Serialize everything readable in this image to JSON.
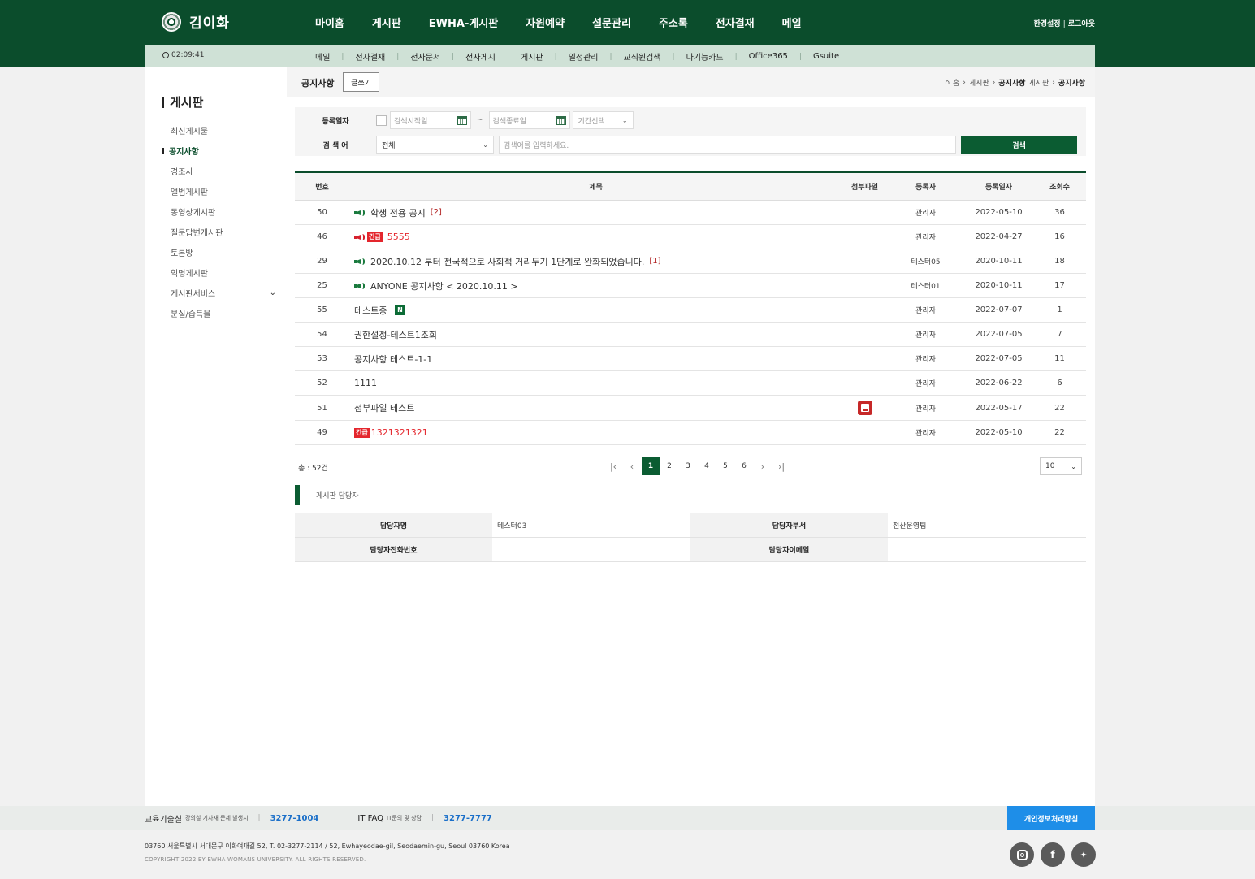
{
  "header": {
    "logo_name": "김이화",
    "gnb": [
      "마이홈",
      "게시판",
      "EWHA-게시판",
      "자원예약",
      "설문관리",
      "주소록",
      "전자결재",
      "메일"
    ],
    "util": {
      "settings": "환경설정",
      "logout": "로그아웃"
    }
  },
  "subbar": {
    "timer": "02:09:41",
    "items": [
      "메일",
      "전자결재",
      "전자문서",
      "전자게시",
      "게시판",
      "일정관리",
      "교직원검색",
      "다기능카드",
      "Office365",
      "Gsuite"
    ]
  },
  "lnb": {
    "title": "게시판",
    "items": [
      "최신게시물",
      "공지사항",
      "경조사",
      "앨범게시판",
      "동영상게시판",
      "질문답변게시판",
      "토론방",
      "익명게시판",
      "게시판서비스",
      "분실/습득물"
    ]
  },
  "content": {
    "page_title": "공지사항",
    "write_button": "글쓰기",
    "breadcrumb": {
      "home": "홈",
      "board": "게시판",
      "sub_bold": "공지사항",
      "sub_rest": "게시판",
      "current": "공지사항"
    }
  },
  "search": {
    "date_label": "등록일자",
    "start_placeholder": "검색시작일",
    "tilde": "~",
    "end_placeholder": "검색종료일",
    "period_select": "기간선택",
    "keyword_label": "검 색 어",
    "scope_select": "전체",
    "keyword_placeholder": "검색어를 입력하세요.",
    "button": "검색"
  },
  "table": {
    "headers": {
      "no": "번호",
      "title": "제목",
      "file": "첨부파일",
      "writer": "등록자",
      "date": "등록일자",
      "views": "조회수"
    },
    "rows": [
      {
        "no": "50",
        "title": "학생 전용 공지",
        "comments": "[2]",
        "writer": "관리자",
        "date": "2022-05-10",
        "views": "36"
      },
      {
        "no": "46",
        "badge": "긴급",
        "title": "5555",
        "comments": "",
        "writer": "관리자",
        "date": "2022-04-27",
        "views": "16"
      },
      {
        "no": "29",
        "title": "2020.10.12 부터 전국적으로 사회적 거리두기 1단계로 완화되었습니다.",
        "comments": "[1]",
        "writer": "테스터05",
        "date": "2020-10-11",
        "views": "18"
      },
      {
        "no": "25",
        "title": "ANYONE 공지사항 < 2020.10.11 >",
        "comments": "",
        "writer": "테스터01",
        "date": "2020-10-11",
        "views": "17"
      },
      {
        "no": "55",
        "title": "테스트중",
        "new_badge": "N",
        "writer": "관리자",
        "date": "2022-07-07",
        "views": "1"
      },
      {
        "no": "54",
        "title": "권한설정-테스트1조회",
        "writer": "관리자",
        "date": "2022-07-05",
        "views": "7"
      },
      {
        "no": "53",
        "title": "공지사항 테스트-1-1",
        "writer": "관리자",
        "date": "2022-07-05",
        "views": "11"
      },
      {
        "no": "52",
        "title": "1111",
        "writer": "관리자",
        "date": "2022-06-22",
        "views": "6"
      },
      {
        "no": "51",
        "title": "첨부파일 테스트",
        "attachment_icon": "pdf-file-icon",
        "writer": "관리자",
        "date": "2022-05-17",
        "views": "22"
      },
      {
        "no": "49",
        "badge": "긴급",
        "title": "1321321321",
        "writer": "관리자",
        "date": "2022-05-10",
        "views": "22"
      }
    ]
  },
  "paging": {
    "total": "총 : 52건",
    "pages": [
      "1",
      "2",
      "3",
      "4",
      "5",
      "6"
    ],
    "current": "1",
    "page_size": "10"
  },
  "manager": {
    "title": "게시판 담당자",
    "name_label": "담당자명",
    "name_value": "테스터03",
    "dept_label": "담당자부서",
    "dept_value": "전산운영팀",
    "phone_label": "담당자전화번호",
    "phone_value": "",
    "email_label": "담당자이메일",
    "email_value": ""
  },
  "footer": {
    "edu_label": "교육기술실",
    "edu_small": "강의실 기자재 문제 발생시",
    "edu_phone": "3277-1004",
    "it_label": "IT FAQ",
    "it_small": "IT문의 및 상담",
    "it_phone": "3277-7777",
    "privacy": "개인정보처리방침",
    "address": "03760 서울특별시 서대문구 이화여대길 52, T. 02-3277-2114 / 52, Ewhayeodae-gil, Seodaemin-gu, Seoul 03760 Korea",
    "copyright": "COPYRIGHT 2022 BY EWHA WOMANS UNIVERSITY. ALL RIGHTS RESERVED.",
    "social": [
      "instagram-icon",
      "facebook-icon",
      "twitter-icon"
    ]
  },
  "colors": {
    "brand_green": "#0b4d2c",
    "button_green": "#0b5c32",
    "urgent_red": "#e4262d",
    "privacy_blue": "#1e8ee8"
  }
}
